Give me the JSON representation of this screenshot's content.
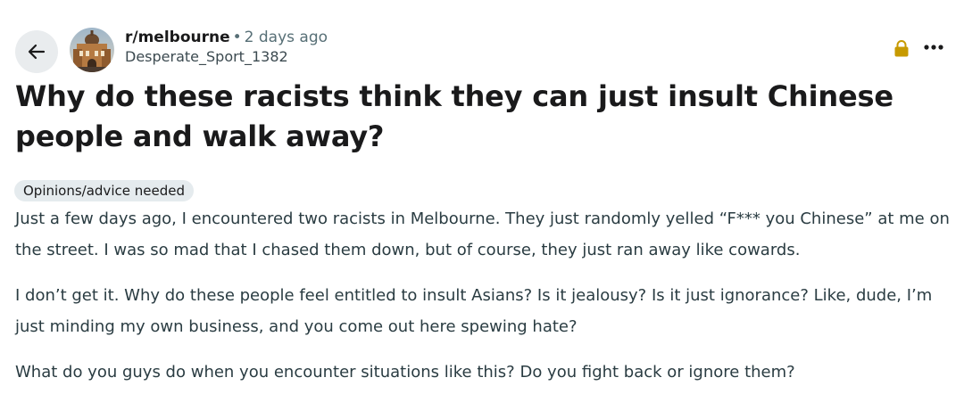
{
  "post": {
    "subreddit": "r/melbourne",
    "separator": "•",
    "time_ago": "2 days ago",
    "author": "Desperate_Sport_1382",
    "title": "Why do these racists think they can just insult Chinese people and walk away?",
    "flair": "Opinions/advice needed",
    "paragraphs": [
      "Just a few days ago, I encountered two racists in Melbourne. They just randomly yelled “F*** you Chinese” at me on the street. I was so mad that I chased them down, but of course, they just ran away like cowards.",
      "I don’t get it. Why do these people feel entitled to insult Asians? Is it jealousy? Is it just ignorance? Like, dude, I’m just minding my own business, and you come out here spewing hate?",
      "What do you guys do when you encounter situations like this? Do you fight back or ignore them?"
    ]
  },
  "icons": {
    "back": "arrow-left-icon",
    "lock": "lock-icon",
    "more": "more-horizontal-icon"
  },
  "colors": {
    "lock": "#c79a00",
    "back_bg": "#e9ecee",
    "flair_bg": "#e5ebee",
    "meta_gray": "#576f76",
    "text": "#1a1a1b",
    "body_text": "#2a3c42"
  }
}
